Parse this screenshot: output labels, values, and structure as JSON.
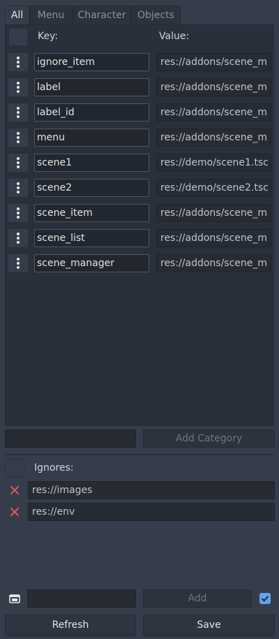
{
  "tabs": [
    {
      "label": "All",
      "active": true
    },
    {
      "label": "Menu",
      "active": false
    },
    {
      "label": "Character",
      "active": false
    },
    {
      "label": "Objects",
      "active": false
    }
  ],
  "table": {
    "key_header": "Key:",
    "value_header": "Value:",
    "rows": [
      {
        "key": "ignore_item",
        "value": "res://addons/scene_m"
      },
      {
        "key": "label",
        "value": "res://addons/scene_m"
      },
      {
        "key": "label_id",
        "value": "res://addons/scene_m"
      },
      {
        "key": "menu",
        "value": "res://addons/scene_m"
      },
      {
        "key": "scene1",
        "value": "res://demo/scene1.tsc"
      },
      {
        "key": "scene2",
        "value": "res://demo/scene2.tsc"
      },
      {
        "key": "scene_item",
        "value": "res://addons/scene_m"
      },
      {
        "key": "scene_list",
        "value": "res://addons/scene_m"
      },
      {
        "key": "scene_manager",
        "value": "res://addons/scene_m"
      }
    ]
  },
  "category": {
    "input_value": "",
    "add_label": "Add Category"
  },
  "ignores": {
    "header": "Ignores:",
    "items": [
      "res://images",
      "res://env"
    ]
  },
  "bottom": {
    "path_value": "",
    "add_label": "Add",
    "checkbox_checked": true,
    "refresh_label": "Refresh",
    "save_label": "Save"
  },
  "colors": {
    "background": "#363d4a",
    "panel": "#2a303b",
    "remove_icon": "#e05757",
    "checkbox": "#5fa5ee"
  }
}
